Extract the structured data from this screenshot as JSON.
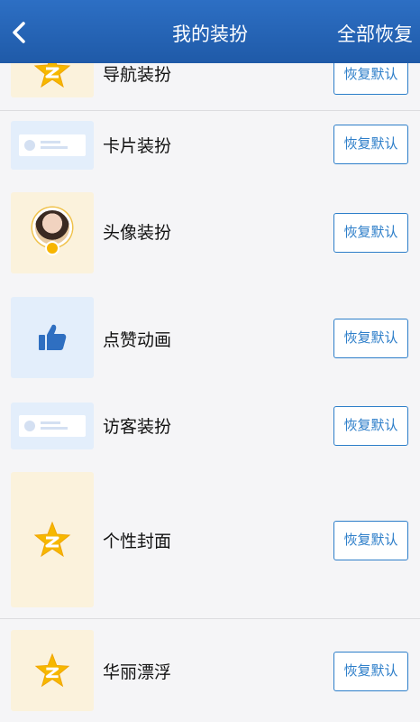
{
  "header": {
    "title": "我的装扮",
    "action": "全部恢复"
  },
  "items": [
    {
      "label": "导航装扮",
      "button": "恢复默认",
      "icon": "qq-star-icon"
    },
    {
      "label": "卡片装扮",
      "button": "恢复默认",
      "icon": "card-icon"
    },
    {
      "label": "头像装扮",
      "button": "恢复默认",
      "icon": "avatar-icon"
    },
    {
      "label": "点赞动画",
      "button": "恢复默认",
      "icon": "thumbs-up-icon"
    },
    {
      "label": "访客装扮",
      "button": "恢复默认",
      "icon": "card-icon"
    },
    {
      "label": "个性封面",
      "button": "恢复默认",
      "icon": "qq-star-icon"
    },
    {
      "label": "华丽漂浮",
      "button": "恢复默认",
      "icon": "qq-star-icon"
    }
  ],
  "colors": {
    "header": "#1f5aa8",
    "accent": "#2d7ec9",
    "thumb_warm": "#fbf2dc",
    "thumb_cool": "#e3eefb"
  }
}
